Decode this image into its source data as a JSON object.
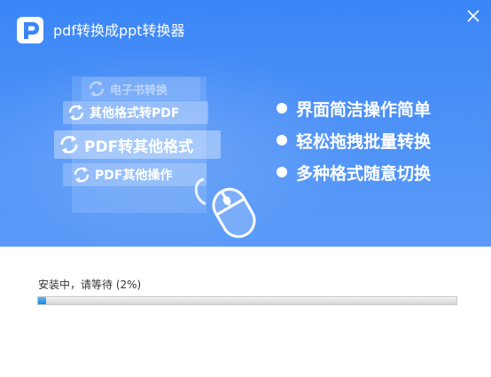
{
  "app": {
    "title": "pdf转换成ppt转换器",
    "logo_icon": "pdf-logo-icon",
    "close_icon": "close-icon",
    "brand_color": "#3a86f7"
  },
  "illustration": {
    "cards": [
      {
        "label": "电子书转换",
        "icon": "convert-arrows-icon"
      },
      {
        "label": "其他格式转PDF",
        "icon": "convert-arrows-icon"
      },
      {
        "label": "PDF转其他格式",
        "icon": "convert-arrows-icon"
      },
      {
        "label": "PDF其他操作",
        "icon": "convert-arrows-icon"
      }
    ],
    "mouse_icon": "mouse-icon"
  },
  "features": [
    "界面简洁操作简单",
    "轻松拖拽批量转换",
    "多种格式随意切换"
  ],
  "install": {
    "status_text": "安装中，请等待 (2%)",
    "progress": 0.02,
    "progress_color": "#1e8be0"
  }
}
